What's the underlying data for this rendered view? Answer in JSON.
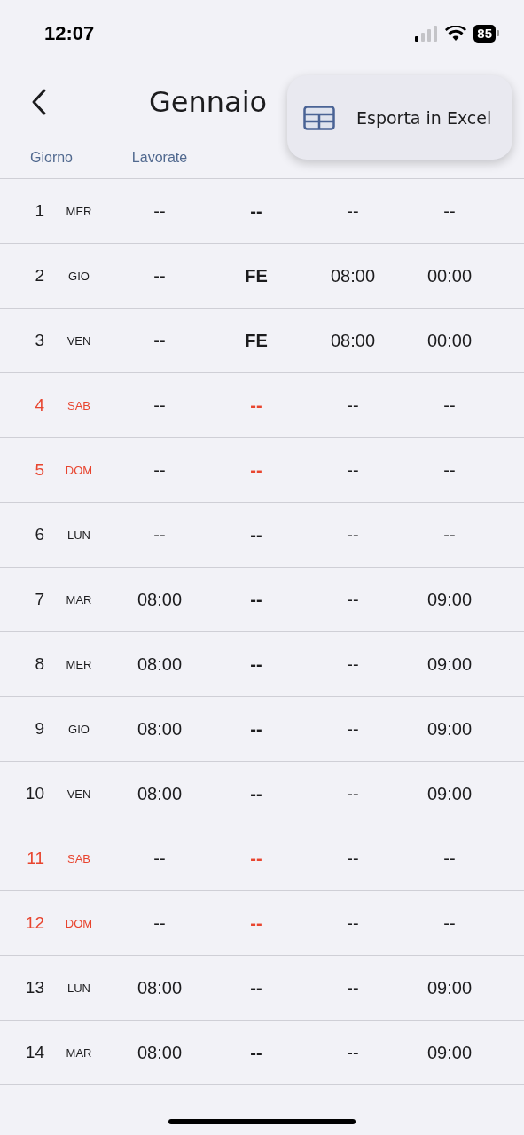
{
  "status_bar": {
    "time": "12:07",
    "battery": "85"
  },
  "header": {
    "title": "Gennaio"
  },
  "menu": {
    "items": [
      {
        "label": "Esporta in Excel"
      }
    ]
  },
  "table": {
    "columns": [
      "Giorno",
      "Lavorate"
    ],
    "rows": [
      {
        "weekend": false,
        "cells": [
          {
            "day": "1",
            "weekday": "MER"
          },
          "--",
          "--",
          "--",
          "--"
        ]
      },
      {
        "weekend": false,
        "cells": [
          {
            "day": "2",
            "weekday": "GIO"
          },
          "--",
          "FE",
          "08:00",
          "00:00"
        ]
      },
      {
        "weekend": false,
        "cells": [
          {
            "day": "3",
            "weekday": "VEN"
          },
          "--",
          "FE",
          "08:00",
          "00:00"
        ]
      },
      {
        "weekend": true,
        "cells": [
          {
            "day": "4",
            "weekday": "SAB"
          },
          "--",
          "--",
          "--",
          "--"
        ]
      },
      {
        "weekend": true,
        "cells": [
          {
            "day": "5",
            "weekday": "DOM"
          },
          "--",
          "--",
          "--",
          "--"
        ]
      },
      {
        "weekend": false,
        "cells": [
          {
            "day": "6",
            "weekday": "LUN"
          },
          "--",
          "--",
          "--",
          "--"
        ]
      },
      {
        "weekend": false,
        "cells": [
          {
            "day": "7",
            "weekday": "MAR"
          },
          "08:00",
          "--",
          "--",
          "09:00"
        ]
      },
      {
        "weekend": false,
        "cells": [
          {
            "day": "8",
            "weekday": "MER"
          },
          "08:00",
          "--",
          "--",
          "09:00"
        ]
      },
      {
        "weekend": false,
        "cells": [
          {
            "day": "9",
            "weekday": "GIO"
          },
          "08:00",
          "--",
          "--",
          "09:00"
        ]
      },
      {
        "weekend": false,
        "cells": [
          {
            "day": "10",
            "weekday": "VEN"
          },
          "08:00",
          "--",
          "--",
          "09:00"
        ]
      },
      {
        "weekend": true,
        "cells": [
          {
            "day": "11",
            "weekday": "SAB"
          },
          "--",
          "--",
          "--",
          "--"
        ]
      },
      {
        "weekend": true,
        "cells": [
          {
            "day": "12",
            "weekday": "DOM"
          },
          "--",
          "--",
          "--",
          "--"
        ]
      },
      {
        "weekend": false,
        "cells": [
          {
            "day": "13",
            "weekday": "LUN"
          },
          "08:00",
          "--",
          "--",
          "09:00"
        ]
      },
      {
        "weekend": false,
        "cells": [
          {
            "day": "14",
            "weekday": "MAR"
          },
          "08:00",
          "--",
          "--",
          "09:00"
        ]
      }
    ]
  }
}
